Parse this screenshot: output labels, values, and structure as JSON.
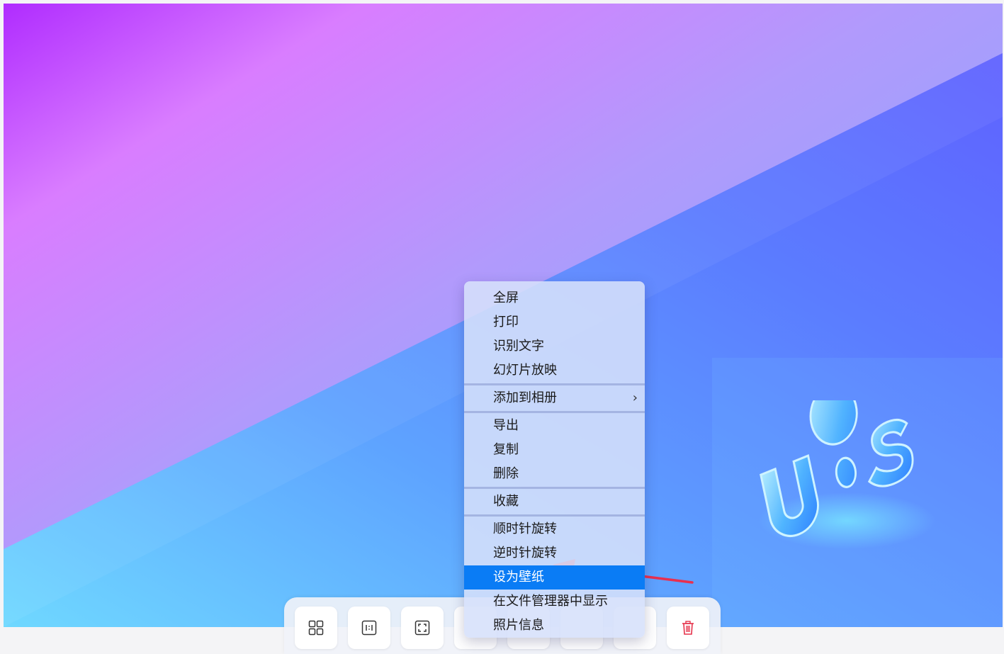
{
  "photo": {
    "logo_text": "UOS"
  },
  "context_menu": {
    "groups": [
      [
        {
          "label": "全屏"
        },
        {
          "label": "打印"
        },
        {
          "label": "识别文字"
        },
        {
          "label": "幻灯片放映"
        }
      ],
      [
        {
          "label": "添加到相册",
          "submenu_indicator": "›"
        }
      ],
      [
        {
          "label": "导出"
        },
        {
          "label": "复制"
        },
        {
          "label": "删除"
        }
      ],
      [
        {
          "label": "收藏"
        }
      ],
      [
        {
          "label": "顺时针旋转"
        },
        {
          "label": "逆时针旋转"
        },
        {
          "label": "设为壁纸",
          "active": true
        },
        {
          "label": "在文件管理器中显示"
        },
        {
          "label": "照片信息"
        }
      ]
    ],
    "active_color": "#0a7cf5"
  },
  "toolbar": {
    "buttons": [
      {
        "icon": "thumbnail-grid-icon"
      },
      {
        "icon": "original-size-icon"
      },
      {
        "icon": "fit-window-icon"
      },
      {
        "icon": "hidden-icon"
      },
      {
        "icon": "hidden-icon"
      },
      {
        "icon": "hidden-icon"
      },
      {
        "icon": "hidden-icon"
      },
      {
        "icon": "trash-icon",
        "color": "#e5324b"
      }
    ]
  },
  "annotation": {
    "color": "#e8304f"
  }
}
